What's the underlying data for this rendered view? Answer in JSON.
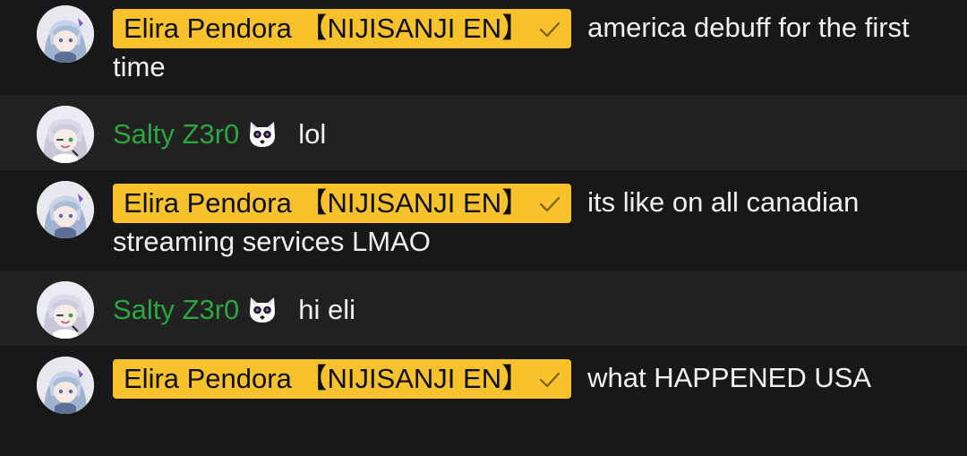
{
  "colors": {
    "owner_chip_bg": "#f7c22b",
    "member_name": "#2ba640",
    "row_dark": "#181818",
    "row_light": "#212121",
    "text": "#f1f1f1"
  },
  "messages": [
    {
      "author": "Elira Pendora 【NIJISANJI EN】",
      "role": "owner",
      "verified_icon": "check-icon",
      "text": "america debuff for the first time"
    },
    {
      "author": "Salty Z3r0",
      "role": "member",
      "badge_icon": "member-badge-icon",
      "text": "lol"
    },
    {
      "author": "Elira Pendora 【NIJISANJI EN】",
      "role": "owner",
      "verified_icon": "check-icon",
      "text": "its like on all canadian streaming services LMAO"
    },
    {
      "author": "Salty Z3r0",
      "role": "member",
      "badge_icon": "member-badge-icon",
      "text": "hi eli"
    },
    {
      "author": "Elira Pendora 【NIJISANJI EN】",
      "role": "owner",
      "verified_icon": "check-icon",
      "text": "what HAPPENED USA"
    }
  ]
}
